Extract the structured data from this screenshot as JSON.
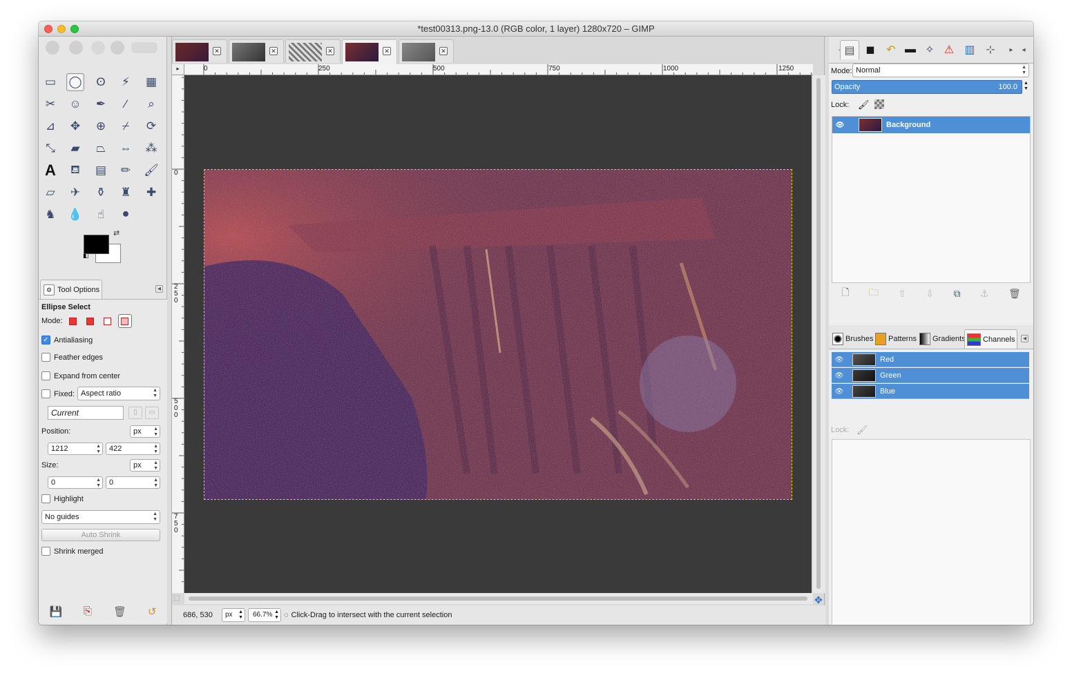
{
  "window": {
    "title": "*test00313.png-13.0 (RGB color, 1 layer) 1280x720 – GIMP"
  },
  "toolbox": {
    "tools": [
      {
        "name": "rect-select-icon",
        "glyph": "▭"
      },
      {
        "name": "ellipse-select-icon",
        "glyph": "◯"
      },
      {
        "name": "free-select-icon",
        "glyph": "ʘ"
      },
      {
        "name": "fuzzy-select-icon",
        "glyph": "⚡"
      },
      {
        "name": "select-by-color-icon",
        "glyph": "▦"
      },
      {
        "name": "scissors-icon",
        "glyph": "✂"
      },
      {
        "name": "foreground-select-icon",
        "glyph": "☺"
      },
      {
        "name": "paths-icon",
        "glyph": "✒"
      },
      {
        "name": "color-picker-icon",
        "glyph": "⁄"
      },
      {
        "name": "zoom-icon",
        "glyph": "⌕"
      },
      {
        "name": "measure-icon",
        "glyph": "⊿"
      },
      {
        "name": "move-icon",
        "glyph": "✥"
      },
      {
        "name": "align-icon",
        "glyph": "⊕"
      },
      {
        "name": "crop-icon",
        "glyph": "⌿"
      },
      {
        "name": "rotate-icon",
        "glyph": "⟳"
      },
      {
        "name": "scale-icon",
        "glyph": "⤡"
      },
      {
        "name": "shear-icon",
        "glyph": "▰"
      },
      {
        "name": "perspective-icon",
        "glyph": "⏢"
      },
      {
        "name": "flip-icon",
        "glyph": "⇔"
      },
      {
        "name": "cage-transform-icon",
        "glyph": "⁂"
      },
      {
        "name": "text-icon",
        "glyph": "A"
      },
      {
        "name": "bucket-fill-icon",
        "glyph": "⛾"
      },
      {
        "name": "gradient-icon",
        "glyph": "▤"
      },
      {
        "name": "pencil-icon",
        "glyph": "✏"
      },
      {
        "name": "paintbrush-icon",
        "glyph": "🖌"
      },
      {
        "name": "eraser-icon",
        "glyph": "▱"
      },
      {
        "name": "airbrush-icon",
        "glyph": "✈"
      },
      {
        "name": "ink-icon",
        "glyph": "⚱"
      },
      {
        "name": "clone-icon",
        "glyph": "♜"
      },
      {
        "name": "heal-icon",
        "glyph": "✚"
      },
      {
        "name": "perspective-clone-icon",
        "glyph": "♞"
      },
      {
        "name": "blur-icon",
        "glyph": "💧"
      },
      {
        "name": "smudge-icon",
        "glyph": "☝"
      },
      {
        "name": "dodge-burn-icon",
        "glyph": "⚫"
      }
    ]
  },
  "tool_options": {
    "tab_label": "Tool Options",
    "title": "Ellipse Select",
    "mode_label": "Mode:",
    "antialiasing": "Antialiasing",
    "feather": "Feather edges",
    "expand": "Expand from center",
    "fixed": "Fixed:",
    "fixed_value": "Aspect ratio",
    "current": "Current",
    "position_label": "Position:",
    "position_unit": "px",
    "pos_x": "1212",
    "pos_y": "422",
    "size_label": "Size:",
    "size_unit": "px",
    "size_w": "0",
    "size_h": "0",
    "highlight": "Highlight",
    "guides": "No guides",
    "auto_shrink": "Auto Shrink",
    "shrink_merged": "Shrink merged"
  },
  "rulers": {
    "h_labels": [
      "0",
      "250",
      "500",
      "750",
      "1000",
      "1250"
    ],
    "v_labels": [
      "0",
      "250",
      "500",
      "750"
    ]
  },
  "status": {
    "coords": "686, 530",
    "unit": "px",
    "zoom": "66.7%",
    "message": "Click-Drag to intersect with the current selection"
  },
  "layers": {
    "mode_label": "Mode:",
    "mode_value": "Normal",
    "opacity_label": "Opacity",
    "opacity_value": "100.0",
    "lock_label": "Lock:",
    "layer_name": "Background"
  },
  "dock2": {
    "tabs": [
      "Brushes",
      "Patterns",
      "Gradients",
      "Channels"
    ],
    "channels": [
      "Red",
      "Green",
      "Blue"
    ],
    "lock_label": "Lock:"
  }
}
